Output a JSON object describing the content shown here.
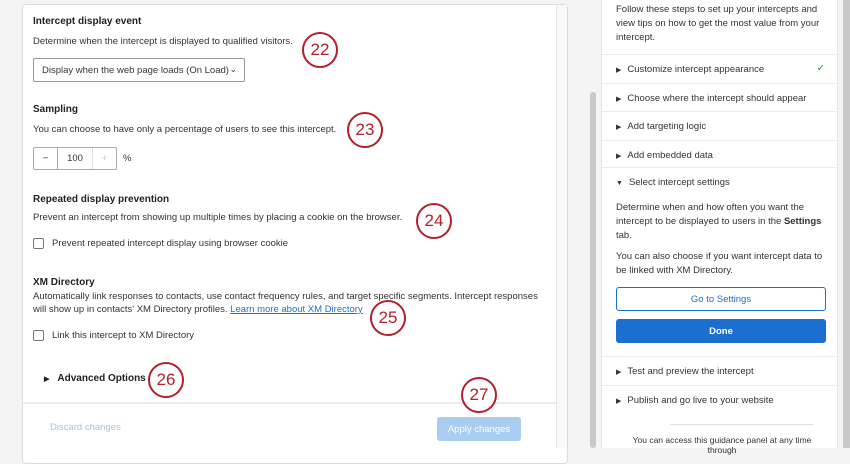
{
  "settings": {
    "display_event": {
      "title": "Intercept display event",
      "desc": "Determine when the intercept is displayed to qualified visitors.",
      "select_value": "Display when the web page loads (On Load)"
    },
    "sampling": {
      "title": "Sampling",
      "desc": "You can choose to have only a percentage of users to see this intercept.",
      "minus": "−",
      "value": "100",
      "plus": "+",
      "unit": "%"
    },
    "repeated": {
      "title": "Repeated display prevention",
      "desc": "Prevent an intercept from showing up multiple times by placing a cookie on the browser.",
      "checkbox_label": "Prevent repeated intercept display using browser cookie"
    },
    "xm": {
      "title": "XM Directory",
      "desc1": "Automatically link responses to contacts, use contact frequency rules, and target specific segments. Intercept responses",
      "desc2": "will show up in contacts' XM Directory profiles.",
      "link": "Learn more about XM Directory",
      "checkbox_label": "Link this intercept to XM Directory"
    },
    "advanced": "Advanced Options",
    "discard": "Discard changes",
    "apply": "Apply changes"
  },
  "badges": [
    "22",
    "23",
    "24",
    "25",
    "26",
    "27"
  ],
  "guide": {
    "intro": "Follow these steps to set up your intercepts and view tips on how to get the most value from your intercept.",
    "steps": [
      "Customize intercept appearance",
      "Choose where the intercept should appear",
      "Add targeting logic",
      "Add embedded data",
      "Select intercept settings",
      "Test and preview the intercept",
      "Publish and go live to your website"
    ],
    "detail1a": "Determine when and how often you want the intercept to be displayed to users in the ",
    "detail1b": "Settings",
    "detail1c": " tab.",
    "detail2": "You can also choose if you want intercept data to be linked with XM Directory.",
    "go_settings": "Go to Settings",
    "done": "Done",
    "footer": "You can access this guidance panel at any time through"
  }
}
